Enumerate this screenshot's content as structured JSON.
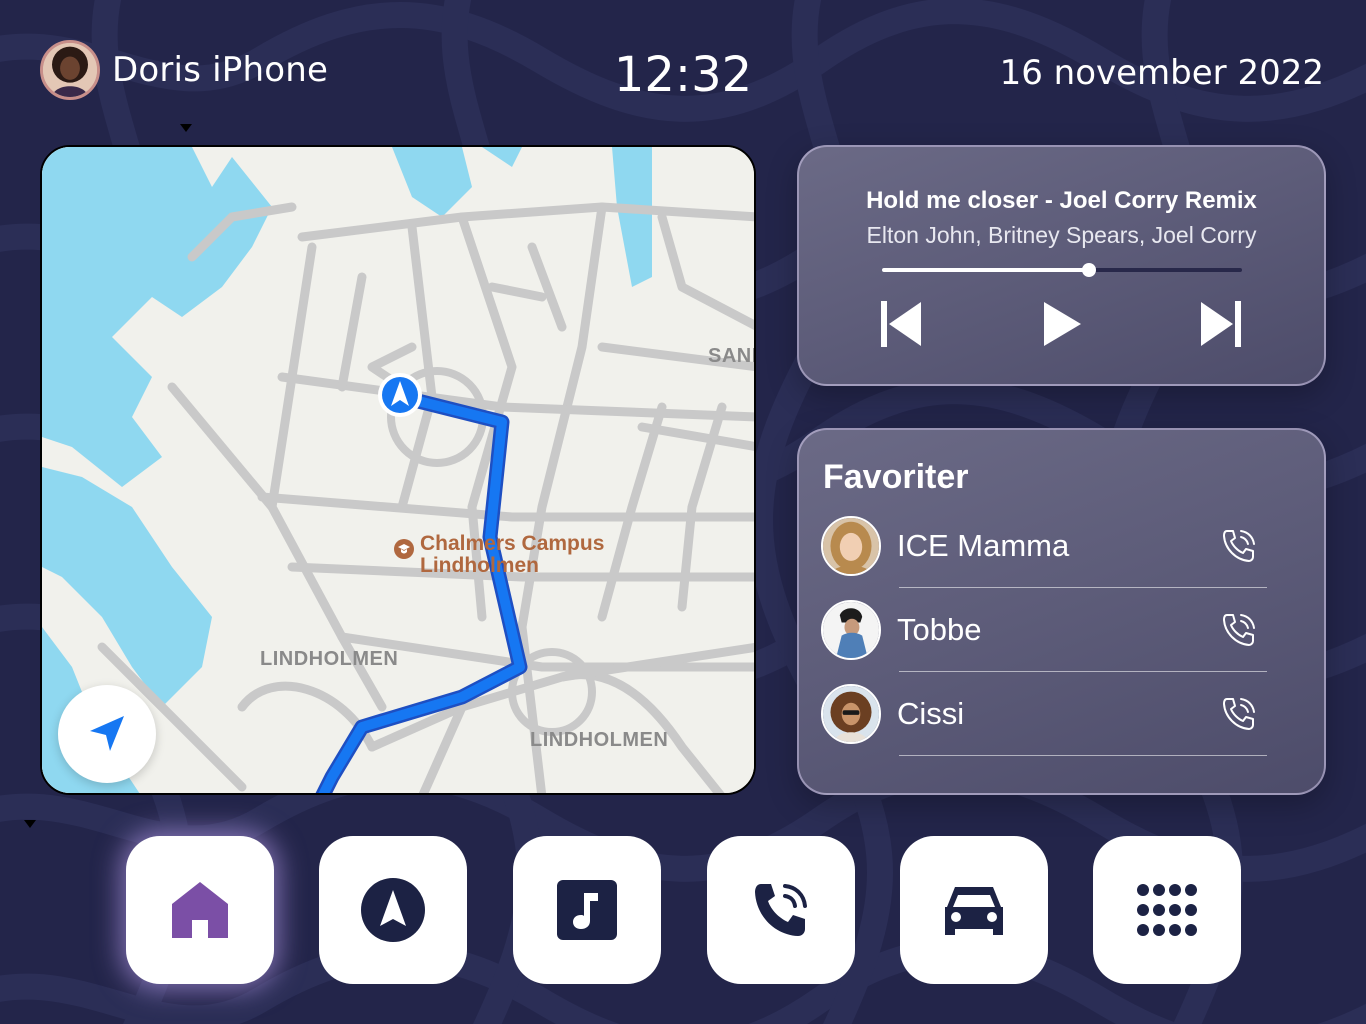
{
  "header": {
    "device_name": "Doris iPhone",
    "time": "12:32",
    "date": "16 november 2022"
  },
  "map": {
    "labels": {
      "poi_line1": "Chalmers Campus",
      "poi_line2": "Lindholmen",
      "district_1": "LINDHOLMEN",
      "district_2": "LINDHOLMEN",
      "district_edge": "SANN"
    },
    "colors": {
      "water": "#8fd8f0",
      "land": "#f1f1ec",
      "road": "#c9c9c9",
      "route": "#1677f2",
      "poi": "#b0683f"
    }
  },
  "music": {
    "title": "Hold me closer - Joel Corry Remix",
    "artist": "Elton John, Britney Spears, Joel Corry",
    "progress": 0.575,
    "controls": {
      "previous": "skip-previous-icon",
      "play": "play-icon",
      "next": "skip-next-icon"
    }
  },
  "favorites": {
    "title": "Favoriter",
    "contacts": [
      {
        "name": "ICE Mamma",
        "action_icon": "phone-call-icon"
      },
      {
        "name": "Tobbe",
        "action_icon": "phone-call-icon"
      },
      {
        "name": "Cissi",
        "action_icon": "phone-call-icon"
      }
    ]
  },
  "dock": {
    "active": "home",
    "items": [
      {
        "id": "home",
        "icon": "home-icon"
      },
      {
        "id": "navigation",
        "icon": "navigation-icon"
      },
      {
        "id": "music",
        "icon": "music-icon"
      },
      {
        "id": "phone",
        "icon": "phone-icon"
      },
      {
        "id": "car",
        "icon": "car-icon"
      },
      {
        "id": "apps",
        "icon": "apps-grid-icon"
      }
    ]
  },
  "theme": {
    "background": "#23254a",
    "active_icon": "#7b4fa6",
    "icon_dark": "#1c2244"
  }
}
